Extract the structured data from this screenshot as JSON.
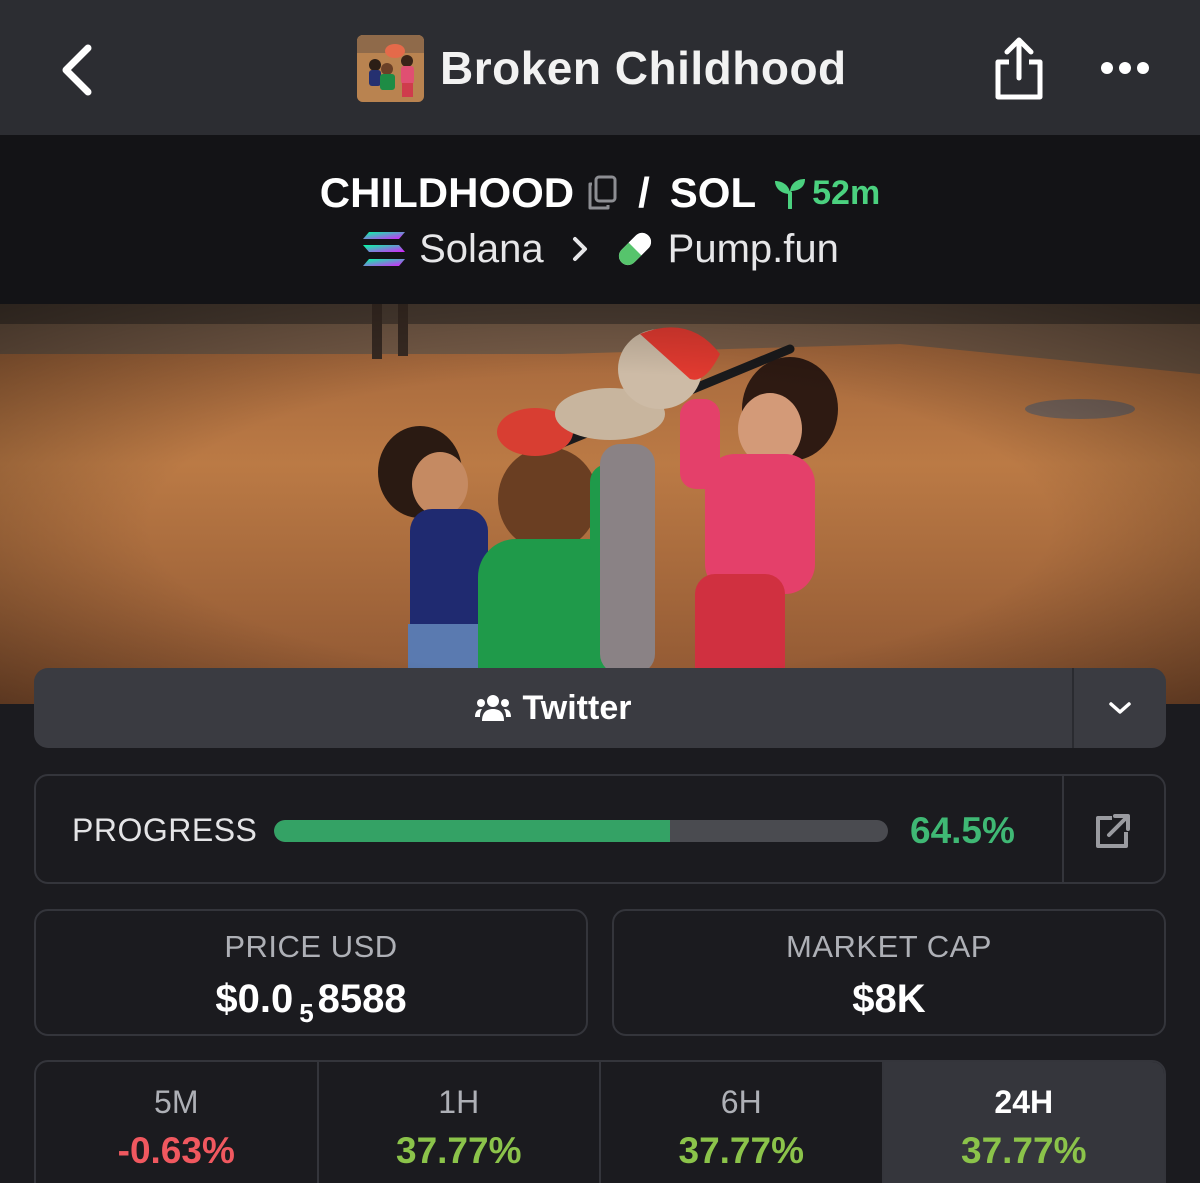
{
  "nav": {
    "title": "Broken Childhood",
    "back_icon": "chevron-left-icon",
    "share_icon": "share-icon",
    "more_icon": "more-icon"
  },
  "pair": {
    "base": "CHILDHOOD",
    "separator": "/",
    "quote": "SOL",
    "age": "52m",
    "age_color": "#4bd17f",
    "chain": "Solana",
    "dex": "Pump.fun"
  },
  "socials": {
    "twitter_label": "Twitter"
  },
  "progress": {
    "label": "PROGRESS",
    "value_text": "64.5%",
    "fraction": 0.645,
    "color": "#34a265"
  },
  "stats": {
    "price": {
      "label": "PRICE USD",
      "prefix": "$0.0",
      "zeros": "5",
      "digits": "8588"
    },
    "market_cap": {
      "label": "MARKET CAP",
      "value": "$8K"
    }
  },
  "timeframes": [
    {
      "label": "5M",
      "value": "-0.63%",
      "color": "#f0585f",
      "active": false
    },
    {
      "label": "1H",
      "value": "37.77%",
      "color": "#8bc34a",
      "active": false
    },
    {
      "label": "6H",
      "value": "37.77%",
      "color": "#8bc34a",
      "active": false
    },
    {
      "label": "24H",
      "value": "37.77%",
      "color": "#8bc34a",
      "active": true
    }
  ]
}
